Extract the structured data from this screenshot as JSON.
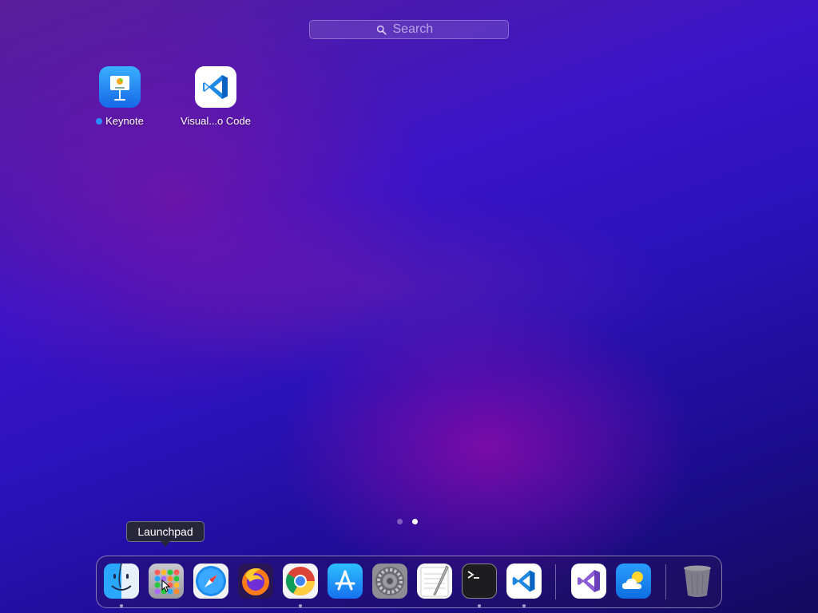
{
  "search": {
    "placeholder": "Search"
  },
  "apps": [
    {
      "name": "Keynote",
      "icon": "keynote-icon",
      "new": true
    },
    {
      "name": "Visual...o Code",
      "icon": "vscode-icon",
      "new": false
    }
  ],
  "pager": {
    "pages": 2,
    "current": 2
  },
  "tooltip": {
    "text": "Launchpad"
  },
  "dock": {
    "items": [
      {
        "name": "Finder",
        "icon": "finder-icon",
        "running": true
      },
      {
        "name": "Launchpad",
        "icon": "launchpad-icon",
        "running": false
      },
      {
        "name": "Safari",
        "icon": "safari-icon",
        "running": false
      },
      {
        "name": "Firefox",
        "icon": "firefox-icon",
        "running": false
      },
      {
        "name": "Google Chrome",
        "icon": "chrome-icon",
        "running": true
      },
      {
        "name": "App Store",
        "icon": "app-store-icon",
        "running": false
      },
      {
        "name": "System Preferences",
        "icon": "system-preferences-icon",
        "running": false
      },
      {
        "name": "TextEdit",
        "icon": "textedit-icon",
        "running": false
      },
      {
        "name": "Terminal",
        "icon": "terminal-icon",
        "running": true
      },
      {
        "name": "Visual Studio Code",
        "icon": "vscode-icon",
        "running": true
      },
      {
        "name": "Visual Studio",
        "icon": "visual-studio-icon",
        "running": false
      },
      {
        "name": "Weather",
        "icon": "weather-icon",
        "running": false
      },
      {
        "name": "Trash",
        "icon": "trash-icon",
        "running": false
      }
    ]
  },
  "colors": {
    "accent": "#2a8cff"
  }
}
